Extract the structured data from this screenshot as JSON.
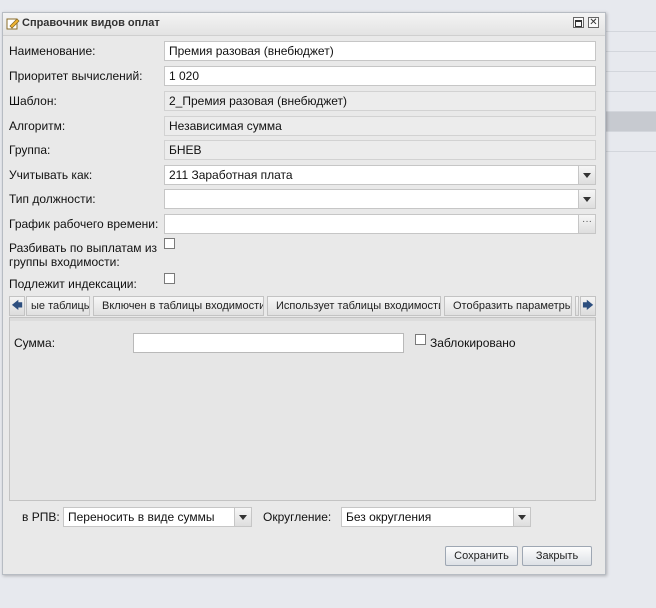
{
  "window": {
    "title": "Справочник видов оплат"
  },
  "form": {
    "name_label": "Наименование:",
    "name_value": "Премия разовая (внебюджет)",
    "priority_label": "Приоритет вычислений:",
    "priority_value": "1 020",
    "template_label": "Шаблон:",
    "template_value": "2_Премия разовая (внебюджет)",
    "algorithm_label": "Алгоритм:",
    "algorithm_value": "Независимая сумма",
    "group_label": "Группа:",
    "group_value": "БНЕВ",
    "account_as_label": "Учитывать как:",
    "account_as_value": "211 Заработная плата",
    "position_type_label": "Тип должности:",
    "position_type_value": "",
    "schedule_label": "График рабочего времени:",
    "schedule_value": "",
    "split_label_line1": "Разбивать по выплатам из",
    "split_label_line2": "группы входимости:",
    "indexation_label": "Подлежит индексации:"
  },
  "tabs": {
    "items": [
      "ые таблицы",
      "Включен в таблицы входимости",
      "Использует таблицы входимости",
      "Отобразить параметры"
    ],
    "left_arrow": "🡄",
    "right_arrow": "🡆"
  },
  "panel": {
    "sum_label": "Сумма:",
    "sum_value": "",
    "locked_label": "Заблокировано"
  },
  "bottom": {
    "rpv_label": "в РПВ:",
    "rpv_value": "Переносить в виде суммы",
    "rounding_label": "Округление:",
    "rounding_value": "Без округления"
  },
  "buttons": {
    "save": "Сохранить",
    "close": "Закрыть"
  }
}
